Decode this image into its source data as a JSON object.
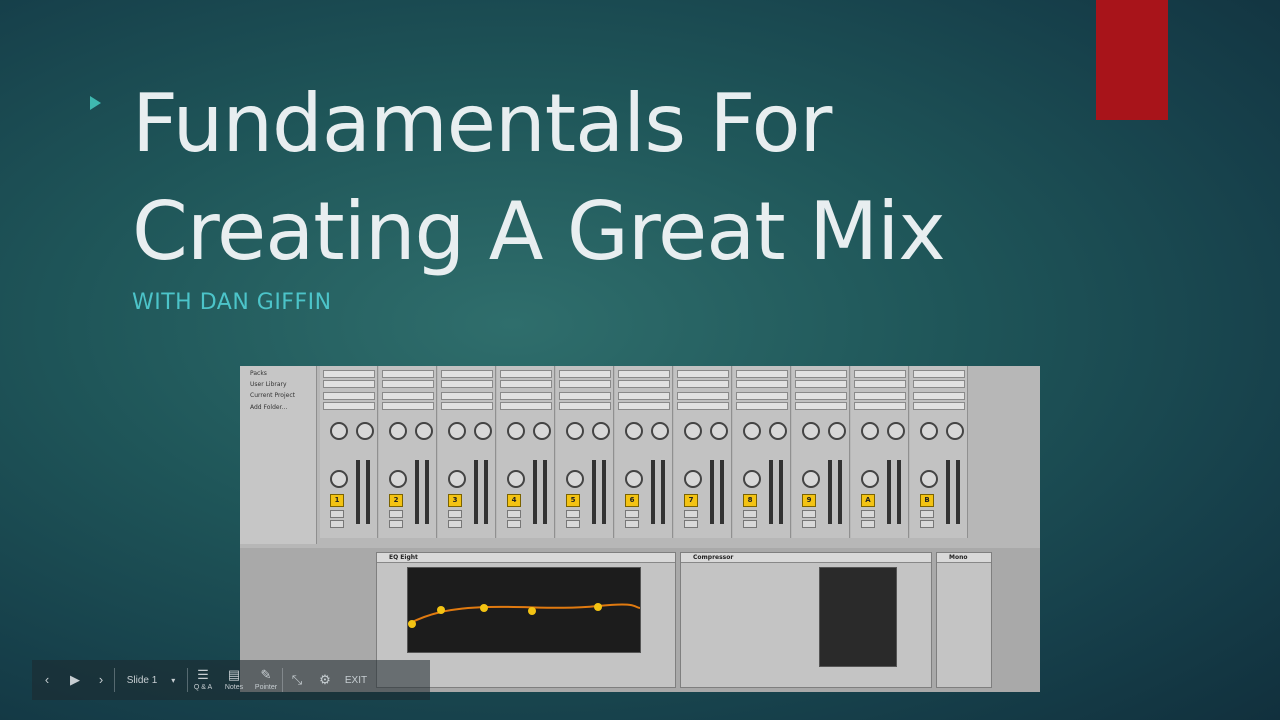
{
  "slide": {
    "title_line1": "Fundamentals For",
    "title_line2": "Creating A Great Mix",
    "subtitle": "WITH DAN GIFFIN",
    "accent_color": "#a8141a",
    "bullet_color": "#3fb8b0"
  },
  "mixer": {
    "browser_items": [
      "Packs",
      "User Library",
      "Current Project",
      "Add Folder..."
    ],
    "track_numbers": [
      "1",
      "2",
      "3",
      "4",
      "5",
      "6",
      "7",
      "8",
      "9",
      "A",
      "B"
    ],
    "devices": [
      "EQ Eight",
      "Compressor",
      "Mono"
    ]
  },
  "toolbar": {
    "prev_icon": "chevron-left-icon",
    "play_icon": "play-icon",
    "next_icon": "chevron-right-icon",
    "slide_label": "Slide 1",
    "qa_label": "Q & A",
    "notes_label": "Notes",
    "pointer_label": "Pointer",
    "exit_label": "EXIT"
  }
}
